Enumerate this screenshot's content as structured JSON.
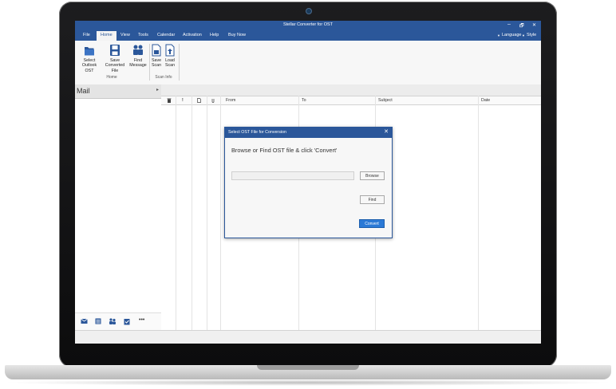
{
  "app": {
    "title": "Stellar Converter for OST",
    "window_controls": {
      "minimize": "–",
      "maximize": "🗗",
      "close": "✕"
    }
  },
  "menu": {
    "items": [
      "File",
      "Home",
      "View",
      "Tools",
      "Calendar",
      "Activation",
      "Help",
      "Buy Now"
    ],
    "active": "Home",
    "right": {
      "language": "Language",
      "style": "Style"
    }
  },
  "ribbon": {
    "home_group": {
      "label": "Home",
      "buttons": [
        {
          "line1": "Select",
          "line2": "Outlook OST",
          "icon": "folder-icon"
        },
        {
          "line1": "Save",
          "line2": "Converted File",
          "icon": "save-icon"
        },
        {
          "line1": "Find",
          "line2": "Message",
          "icon": "find-people-icon"
        }
      ]
    },
    "scan_group": {
      "label": "Scan Info",
      "buttons": [
        {
          "line1": "Save",
          "line2": "Scan",
          "icon": "save-scan-icon"
        },
        {
          "line1": "Load",
          "line2": "Scan",
          "icon": "load-scan-icon"
        }
      ]
    }
  },
  "left_panel": {
    "title": "Mail",
    "pin": "▸",
    "nav": [
      "mail-icon",
      "calendar-list-icon",
      "contacts-icon",
      "tasks-icon",
      "more-icon"
    ],
    "more_label": "•••"
  },
  "grid": {
    "icon_columns": [
      "delete-icon",
      "importance-icon",
      "document-icon",
      "attachment-icon"
    ],
    "importance_label": "!",
    "columns": [
      "From",
      "To",
      "Subject",
      "Date"
    ]
  },
  "dialog": {
    "title": "Select OST File for Conversion",
    "close": "✕",
    "heading": "Browse or Find OST file & click 'Convert'",
    "path_value": "",
    "browse_label": "Browse",
    "find_label": "Find",
    "convert_label": "Convert"
  },
  "colors": {
    "accent": "#2b579a",
    "button_blue": "#2b79d6",
    "laptop_frame": "#111111"
  }
}
